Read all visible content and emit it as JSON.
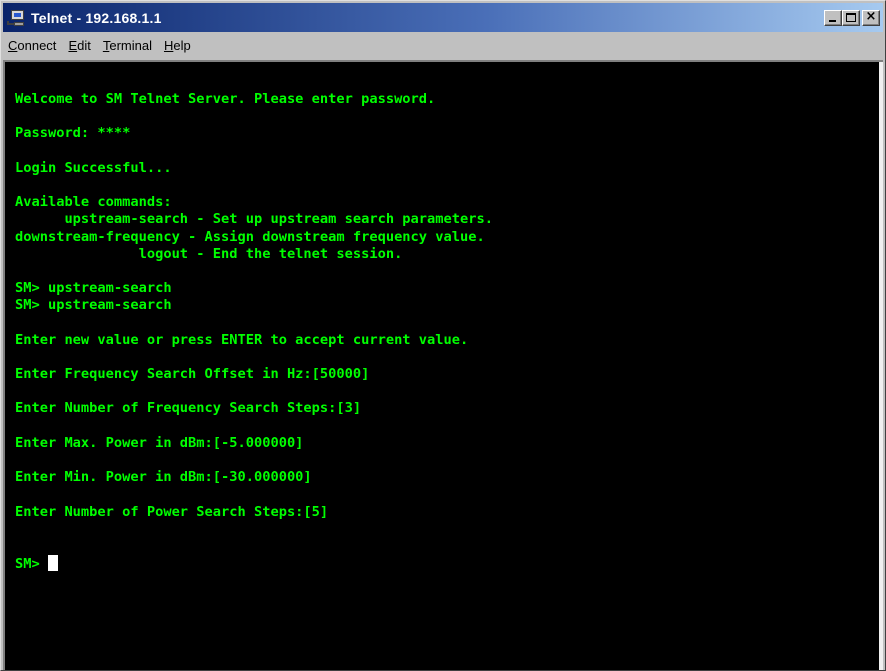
{
  "window": {
    "title": "Telnet - 192.168.1.1",
    "controls": {
      "minimize": "_",
      "maximize": "□",
      "close": "×"
    }
  },
  "menu": [
    {
      "accel": "C",
      "rest": "onnect"
    },
    {
      "accel": "E",
      "rest": "dit"
    },
    {
      "accel": "T",
      "rest": "erminal"
    },
    {
      "accel": "H",
      "rest": "elp"
    }
  ],
  "terminal": {
    "colors": {
      "text": "#00ff00",
      "background": "#000000",
      "cursor": "#ffffff"
    },
    "lines": [
      "Welcome to SM Telnet Server. Please enter password.",
      "",
      "Password: ****",
      "",
      "Login Successful...",
      "",
      "Available commands:",
      "      upstream-search - Set up upstream search parameters.",
      "downstream-frequency - Assign downstream frequency value.",
      "               logout - End the telnet session.",
      "",
      "SM> upstream-search",
      "SM> upstream-search",
      "",
      "Enter new value or press ENTER to accept current value.",
      "",
      "Enter Frequency Search Offset in Hz:[50000]",
      "",
      "Enter Number of Frequency Search Steps:[3]",
      "",
      "Enter Max. Power in dBm:[-5.000000]",
      "",
      "Enter Min. Power in dBm:[-30.000000]",
      "",
      "Enter Number of Power Search Steps:[5]",
      "",
      "",
      "SM> "
    ]
  }
}
